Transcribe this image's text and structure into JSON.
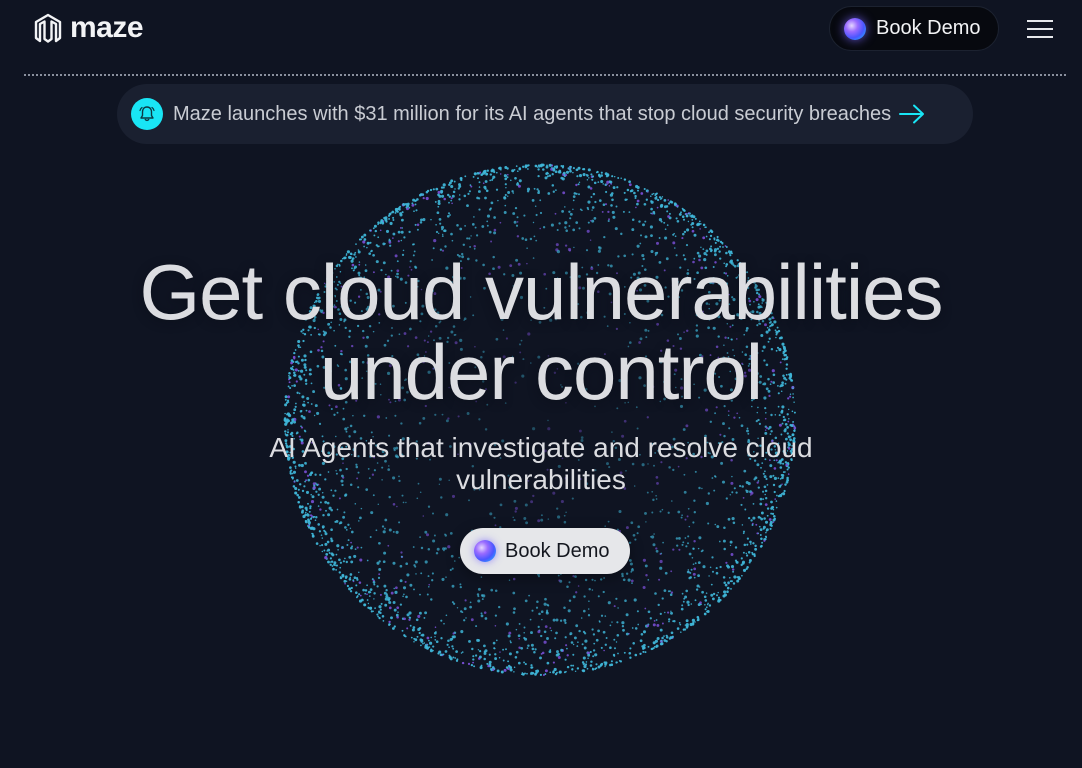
{
  "header": {
    "logo_text": "maze",
    "book_demo_label": "Book Demo"
  },
  "announcement": {
    "text": "Maze launches with $31 million for its AI agents that stop cloud security breaches"
  },
  "hero": {
    "title_line1": "Get cloud vulnerabilities",
    "title_line2": "under control",
    "subtitle_line1": "AI Agents that investigate and resolve cloud",
    "subtitle_line2": "vulnerabilities",
    "cta_label": "Book Demo"
  },
  "colors": {
    "background": "#0f1422",
    "accent_cyan": "#19e5f5",
    "particle_blue": "#3fb6d8",
    "particle_purple": "#7a4fd6",
    "text_primary": "#dcdde1"
  },
  "icons": {
    "logo": "maze-logo-icon",
    "bell": "bell-icon",
    "arrow": "arrow-right-icon",
    "menu": "hamburger-menu-icon",
    "orb": "gradient-orb-icon"
  }
}
